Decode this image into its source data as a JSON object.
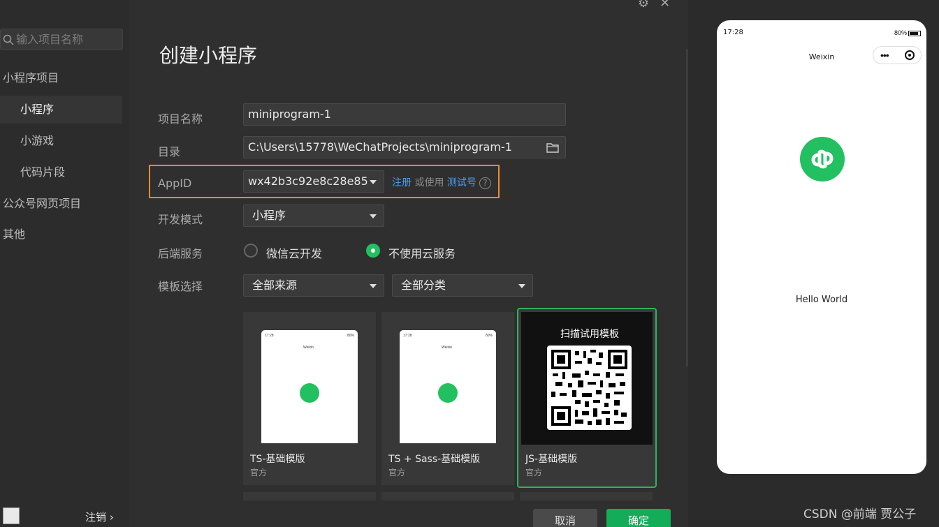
{
  "sidebar": {
    "search_placeholder": "输入项目名称",
    "items": [
      {
        "label": "小程序项目"
      },
      {
        "label": "小程序"
      },
      {
        "label": "小游戏"
      },
      {
        "label": "代码片段"
      },
      {
        "label": "公众号网页项目"
      },
      {
        "label": "其他"
      }
    ],
    "logout_label": "注销 ›"
  },
  "form": {
    "title": "创建小程序",
    "name_label": "项目名称",
    "name_value": "miniprogram-1",
    "dir_label": "目录",
    "dir_value": "C:\\Users\\15778\\WeChatProjects\\miniprogram-1",
    "appid_label": "AppID",
    "appid_value": "wx42b3c92e8c28e85",
    "register_link": "注册",
    "or_use": " 或使用 ",
    "test_link": "测试号",
    "help_glyph": "?",
    "mode_label": "开发模式",
    "mode_value": "小程序",
    "backend_label": "后端服务",
    "backend_opt1": "微信云开发",
    "backend_opt2": "不使用云服务",
    "backend_selected": "不使用云服务",
    "template_label": "模板选择",
    "source_value": "全部来源",
    "category_value": "全部分类"
  },
  "templates": [
    {
      "name": "TS-基础模版",
      "sub": "官方"
    },
    {
      "name": "TS + Sass-基础模版",
      "sub": "官方"
    },
    {
      "name": "JS-基础模版",
      "sub": "官方",
      "overlay": "扫描试用模板"
    }
  ],
  "buttons": {
    "cancel": "取消",
    "ok": "确定"
  },
  "preview": {
    "time": "17:28",
    "battery": "80%",
    "nav_title": "Weixin",
    "hello": "Hello World",
    "mini_time": "17:28",
    "mini_batt": "80%",
    "mini_nav": "Weixin"
  },
  "watermark": "CSDN @前端 贾公子",
  "colors": {
    "accent_green": "#22c060",
    "highlight_orange": "#f38a2c",
    "link_blue": "#4a9ef5"
  }
}
